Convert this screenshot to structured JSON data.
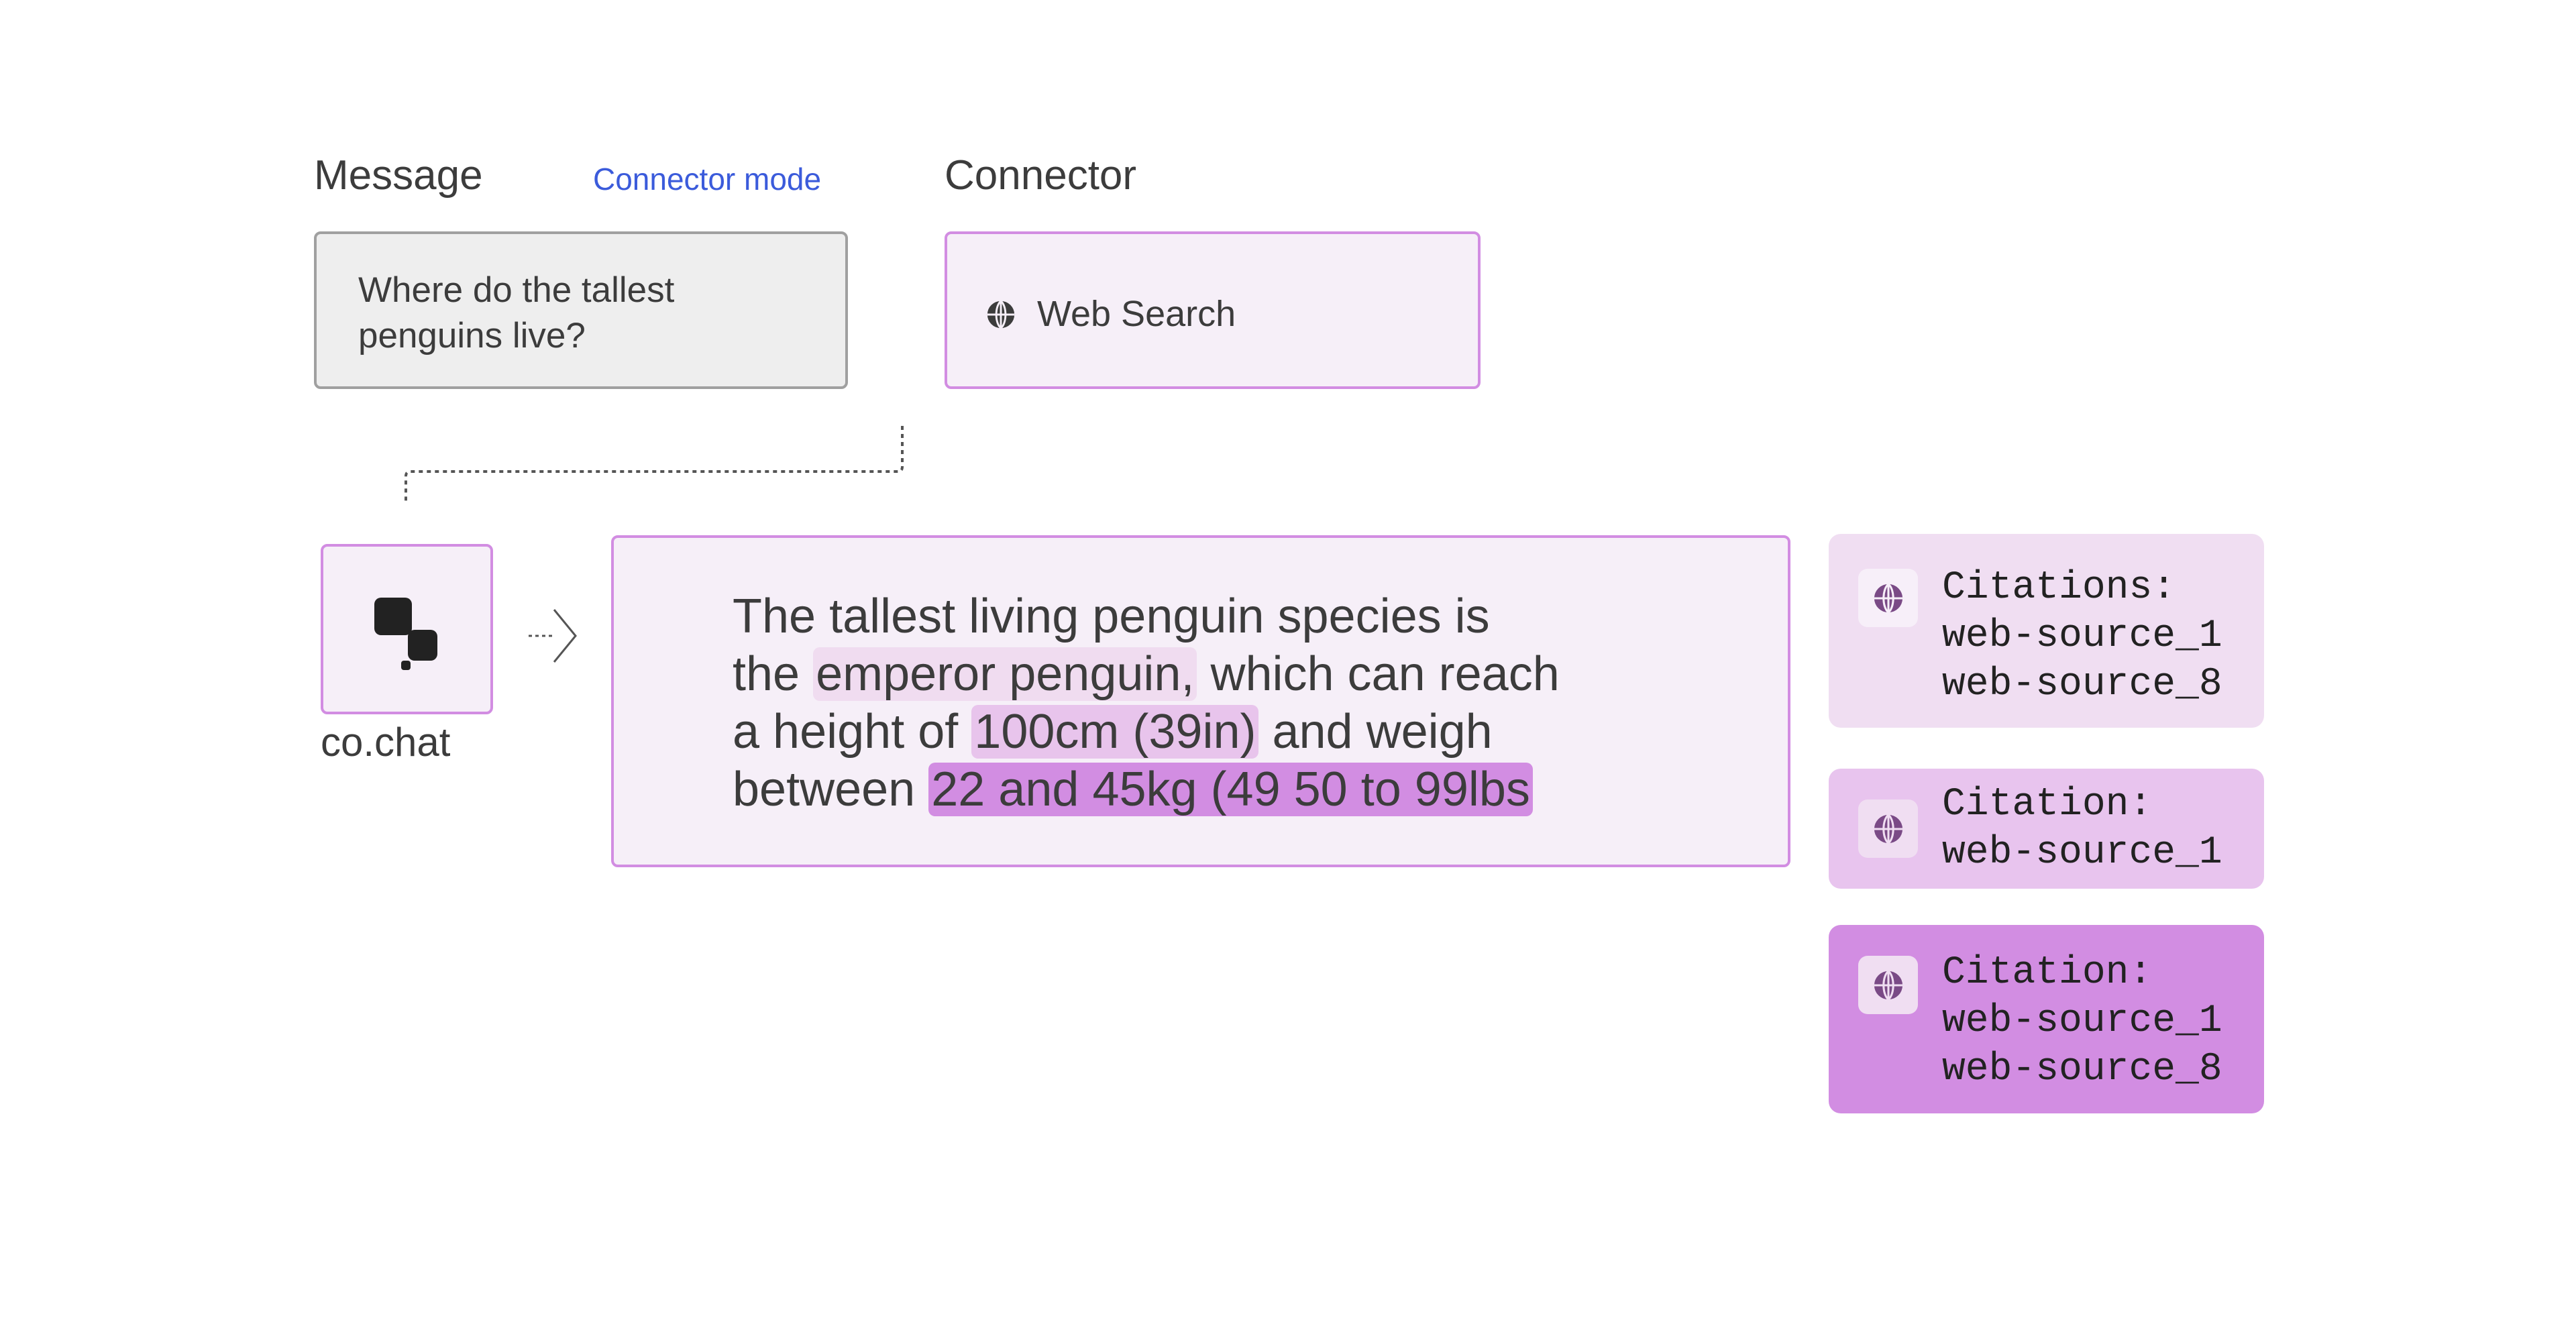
{
  "headers": {
    "message": "Message",
    "connector_mode": "Connector mode",
    "connector": "Connector"
  },
  "message": {
    "line1": "Where do the tallest",
    "line2": "penguins live?"
  },
  "connector": {
    "icon": "globe-icon",
    "label": "Web Search"
  },
  "chat": {
    "icon": "cohere-chat-logo-icon",
    "name": "co.chat"
  },
  "response": {
    "l1": "The tallest living penguin species is",
    "l2_pre": "the ",
    "l2_hl": "emperor penguin,",
    "l2_post": " which can reach",
    "l3_pre": "a height of ",
    "l3_hl": "100cm (39in)",
    "l3_post": " and weigh",
    "l4_pre": "between ",
    "l4_hl": "22 and 45kg (49 50 to 99lbs"
  },
  "citations": [
    {
      "title": "Citations:",
      "sources": [
        "web-source_1",
        "web-source_8"
      ],
      "color": "#f0def2",
      "icon_bg": "#f7eff9"
    },
    {
      "title": "Citation:",
      "sources": [
        "web-source_1"
      ],
      "color": "#e8c4ee",
      "icon_bg": "#f0def2"
    },
    {
      "title": "Citation:",
      "sources": [
        "web-source_1",
        "web-source_8"
      ],
      "color": "#d28de2",
      "icon_bg": "#f0def2"
    }
  ],
  "colors": {
    "accent_border": "#d28de2",
    "link": "#3b5bdb",
    "globe": "#7a4a86"
  }
}
